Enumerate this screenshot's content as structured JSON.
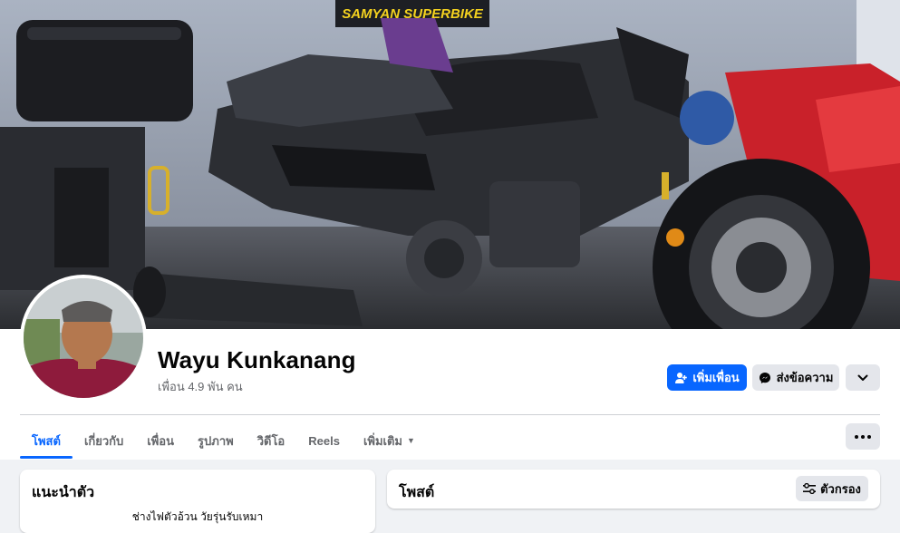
{
  "profile": {
    "name": "Wayu Kunkanang",
    "friends_text": "เพื่อน 4.9 พัน คน"
  },
  "cover": {
    "banner_text": "SAMYAN SUPERBIKE"
  },
  "actions": {
    "add_friend_label": "เพิ่มเพื่อน",
    "message_label": "ส่งข้อความ",
    "more_icon": "chevron-down-icon"
  },
  "tabs": [
    {
      "label": "โพสต์",
      "active": true
    },
    {
      "label": "เกี่ยวกับ",
      "active": false
    },
    {
      "label": "เพื่อน",
      "active": false
    },
    {
      "label": "รูปภาพ",
      "active": false
    },
    {
      "label": "วิดีโอ",
      "active": false
    },
    {
      "label": "Reels",
      "active": false
    },
    {
      "label": "เพิ่มเติม",
      "active": false
    }
  ],
  "intro": {
    "title": "แนะนำตัว",
    "bio": "ช่างไฟตัวอ้วน วัยรุ่นรับเหมา"
  },
  "posts": {
    "title": "โพสต์",
    "filter_label": "ตัวกรอง"
  },
  "colors": {
    "primary": "#0866ff",
    "secondary_button": "#e4e6eb",
    "page_bg": "#f0f2f5",
    "muted_text": "#65676b"
  }
}
